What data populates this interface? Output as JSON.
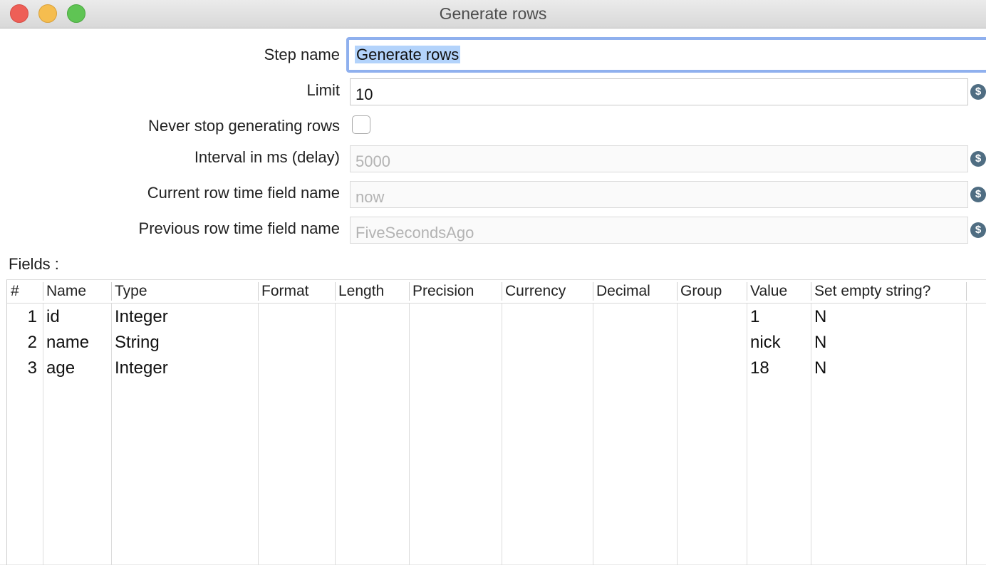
{
  "window": {
    "title": "Generate rows"
  },
  "form": {
    "step_name_label": "Step name",
    "step_name_value": "Generate rows",
    "limit_label": "Limit",
    "limit_value": "10",
    "never_stop_label": "Never stop generating rows",
    "never_stop_checked": false,
    "interval_label": "Interval in ms (delay)",
    "interval_value": "5000",
    "current_time_label": "Current row time field name",
    "current_time_value": "now",
    "previous_time_label": "Previous row time field name",
    "previous_time_value": "FiveSecondsAgo",
    "variable_icon": "variable-dollar-icon"
  },
  "fields_label": "Fields :",
  "table": {
    "columns": [
      "#",
      "Name",
      "Type",
      "Format",
      "Length",
      "Precision",
      "Currency",
      "Decimal",
      "Group",
      "Value",
      "Set empty string?"
    ],
    "rows": [
      {
        "num": "1",
        "name": "id",
        "type": "Integer",
        "value": "1",
        "empty": "N"
      },
      {
        "num": "2",
        "name": "name",
        "type": "String",
        "value": "nick",
        "empty": "N"
      },
      {
        "num": "3",
        "name": "age",
        "type": "Integer",
        "value": "18",
        "empty": "N"
      }
    ]
  }
}
